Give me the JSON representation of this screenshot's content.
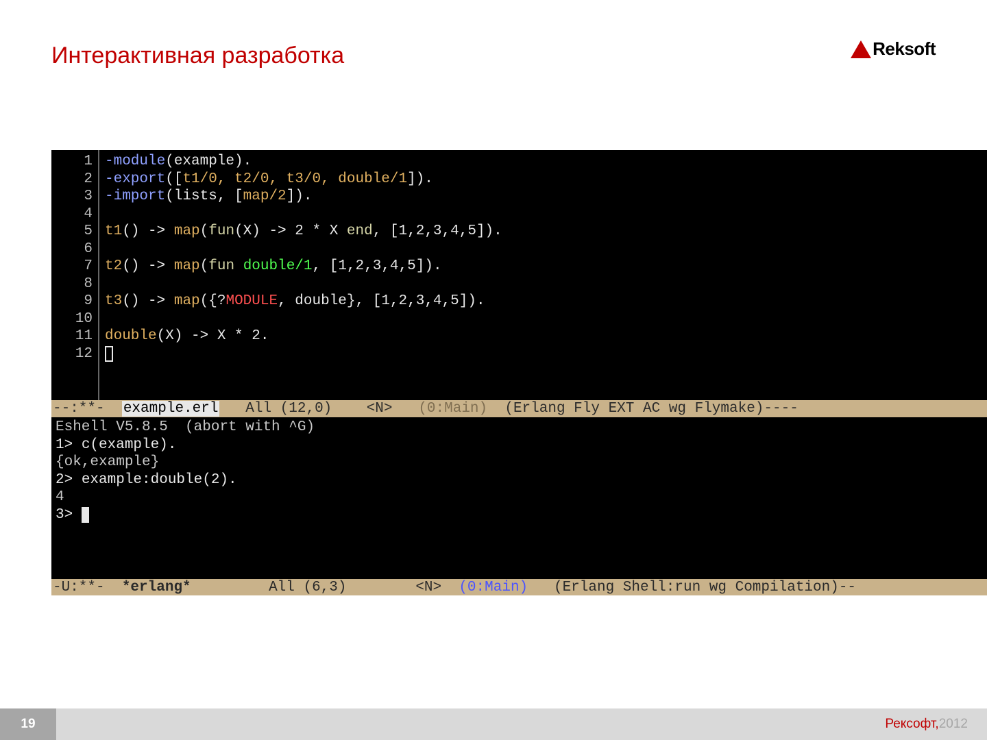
{
  "header": {
    "title": "Интерактивная разработка",
    "logo_text": "Reksoft",
    "logo_color": "#c00000"
  },
  "editor": {
    "line_numbers": [
      "1",
      "2",
      "3",
      "4",
      "5",
      "6",
      "7",
      "8",
      "9",
      "10",
      "11",
      "12"
    ],
    "lines": {
      "l1_dir": "-module",
      "l1_rest": "(example).",
      "l2_dir": "-export",
      "l2_a": "([",
      "l2_b": "t1/0, t2/0, t3/0, double/1",
      "l2_c": "]).",
      "l3_dir": "-import",
      "l3_a": "(lists, [",
      "l3_b": "map/2",
      "l3_c": "]).",
      "l5_a": "t1",
      "l5_b": "() -> ",
      "l5_c": "map",
      "l5_d": "(",
      "l5_e": "fun",
      "l5_f": "(X) -> 2 * X ",
      "l5_g": "end",
      "l5_h": ", [1,2,3,4,5]).",
      "l7_a": "t2",
      "l7_b": "() -> ",
      "l7_c": "map",
      "l7_d": "(",
      "l7_e": "fun",
      "l7_f": " ",
      "l7_g": "double/1",
      "l7_h": ", [1,2,3,4,5]).",
      "l9_a": "t3",
      "l9_b": "() -> ",
      "l9_c": "map",
      "l9_d": "({?",
      "l9_e": "MODULE",
      "l9_f": ", double}, [1,2,3,4,5]).",
      "l11_a": "double",
      "l11_b": "(X) -> X * 2."
    }
  },
  "modeline_top": {
    "left": "--:**-  ",
    "file": "example.erl",
    "pos": "   All (12,0)    ",
    "mode": "<N>",
    "main": "   (0:Main)",
    "right": "  (Erlang Fly EXT AC wg Flymake)----"
  },
  "shell": {
    "banner": "Eshell V5.8.5  (abort with ^G)",
    "p1": "1> ",
    "c1": "c(example).",
    "r1": "{ok,example}",
    "p2": "2> ",
    "c2": "example:double(2).",
    "r2": "4",
    "p3": "3> "
  },
  "modeline_bottom": {
    "left": "-U:**-  ",
    "file": "*erlang*",
    "pos": "         All (6,3)        ",
    "mode": "<N>",
    "main": "  (0:Main)",
    "right": "   (Erlang Shell:run wg Compilation)--"
  },
  "footer": {
    "page": "19",
    "company": "Рексофт,",
    "year": " 2012"
  }
}
